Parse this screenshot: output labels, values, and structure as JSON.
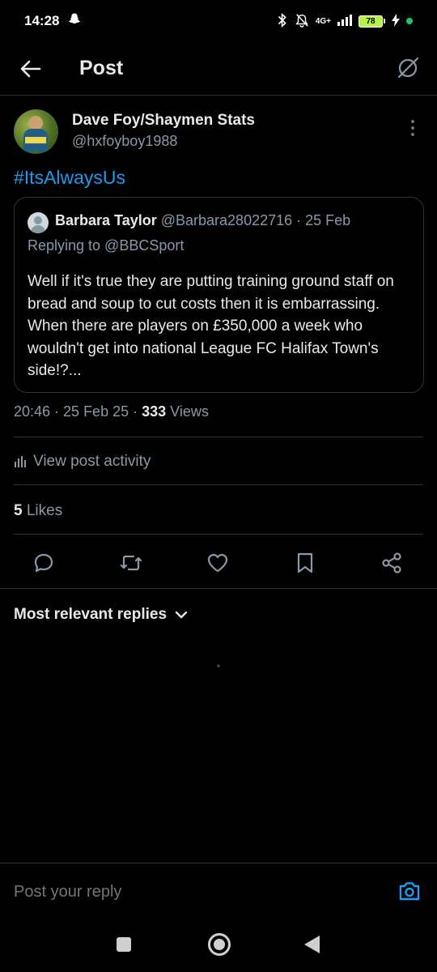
{
  "status_bar": {
    "time": "14:28",
    "network": "4G+",
    "battery": "78"
  },
  "header": {
    "title": "Post"
  },
  "post": {
    "author_name": "Dave Foy/Shaymen Stats",
    "author_handle": "@hxfoyboy1988",
    "text": "#ItsAlwaysUs",
    "quote": {
      "author_name": "Barbara Taylor",
      "author_handle_date": "@Barbara28022716 · 25 Feb",
      "replying_to": "Replying to @BBCSport",
      "text": "Well if it's true they are putting training ground staff on bread and soup to cut costs then it is embarrassing. When there are players on £350,000 a week who wouldn't get into national League FC Halifax Town's side!?..."
    },
    "timestamp": "20:46 · 25 Feb 25 · ",
    "views_count": "333",
    "views_label": " Views",
    "activity_label": "View post activity",
    "likes_count": "5",
    "likes_label": " Likes"
  },
  "replies": {
    "sort_label": "Most relevant replies"
  },
  "reply_bar": {
    "placeholder": "Post your reply"
  },
  "colors": {
    "accent": "#1d9bf0",
    "background": "#000000",
    "secondary_text": "#8b98a5",
    "divider": "#2f3336"
  },
  "icons": [
    "snapchat-icon",
    "bluetooth-icon",
    "mute-icon",
    "signal-icon",
    "battery-icon",
    "charging-icon",
    "back-arrow-icon",
    "grok-icon",
    "more-icon",
    "bar-chart-icon",
    "reply-icon",
    "repost-icon",
    "like-icon",
    "bookmark-icon",
    "share-icon",
    "chevron-down-icon",
    "camera-icon"
  ]
}
